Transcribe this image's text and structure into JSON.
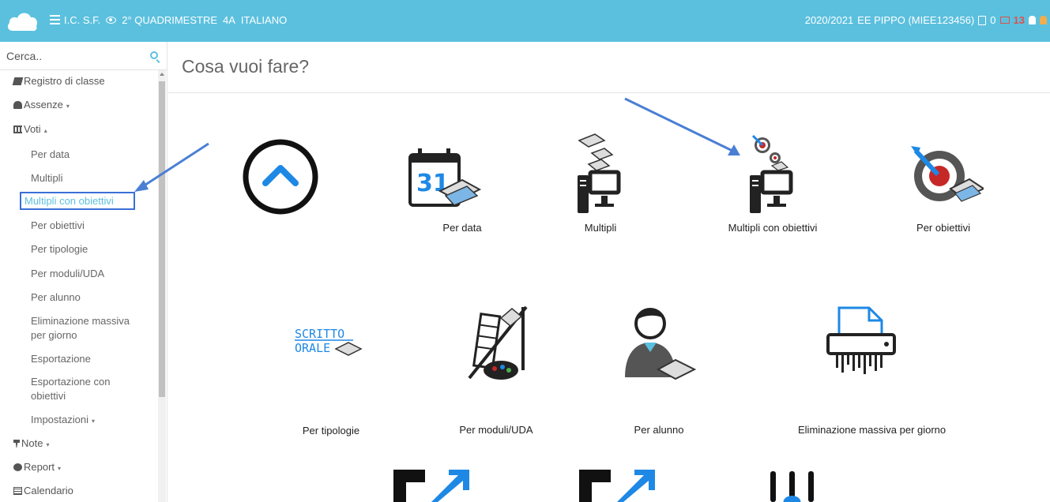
{
  "header": {
    "school": "I.C. S.F.",
    "period": "2° QUADRIMESTRE",
    "class": "4A",
    "subject": "ITALIANO",
    "year": "2020/2021",
    "user": "EE PIPPO (MIEE123456)",
    "docs_count": "0",
    "mail_count": "13",
    "accent_color": "#5bc0de"
  },
  "search": {
    "placeholder": "Cerca.."
  },
  "sidebar": {
    "items": [
      {
        "label": "Registro di classe",
        "icon": "book-icon"
      },
      {
        "label": "Assenze",
        "icon": "user-icon",
        "caret": "▾"
      },
      {
        "label": "Voti",
        "icon": "bank-icon",
        "caret": "▴"
      },
      {
        "label": "Per data"
      },
      {
        "label": "Multipli"
      },
      {
        "label": "Multipli con obiettivi",
        "active": true
      },
      {
        "label": "Per obiettivi"
      },
      {
        "label": "Per tipologie"
      },
      {
        "label": "Per moduli/UDA"
      },
      {
        "label": "Per alunno"
      },
      {
        "label": "Eliminazione massiva"
      },
      {
        "label": "per giorno"
      },
      {
        "label": "Esportazione"
      },
      {
        "label": "Esportazione con"
      },
      {
        "label": "obiettivi"
      },
      {
        "label": "Impostazioni",
        "caret": "▾"
      },
      {
        "label": "Note",
        "icon": "pin-icon",
        "caret": "▾"
      },
      {
        "label": "Report",
        "icon": "pie-chart-icon",
        "caret": "▾"
      },
      {
        "label": "Calendario",
        "icon": "calendar-icon"
      }
    ]
  },
  "main": {
    "title": "Cosa vuoi fare?",
    "tiles": [
      {
        "label": "Per data",
        "icon": "calendar-graduation-icon"
      },
      {
        "label": "Multipli",
        "icon": "computer-graduation-icon"
      },
      {
        "label": "Multipli con obiettivi",
        "icon": "computer-target-icon"
      },
      {
        "label": "Per obiettivi",
        "icon": "target-icon"
      },
      {
        "label": "Per tipologie",
        "icon": "scritto-orale-icon"
      },
      {
        "label": "Per moduli/UDA",
        "icon": "pisa-tower-icon"
      },
      {
        "label": "Per alunno",
        "icon": "student-icon"
      },
      {
        "label": "Eliminazione massiva per giorno",
        "icon": "shredder-icon"
      }
    ],
    "tipologie_text": {
      "line1": "SCRITTO",
      "line2": "ORALE"
    },
    "calendar_day": "31"
  }
}
